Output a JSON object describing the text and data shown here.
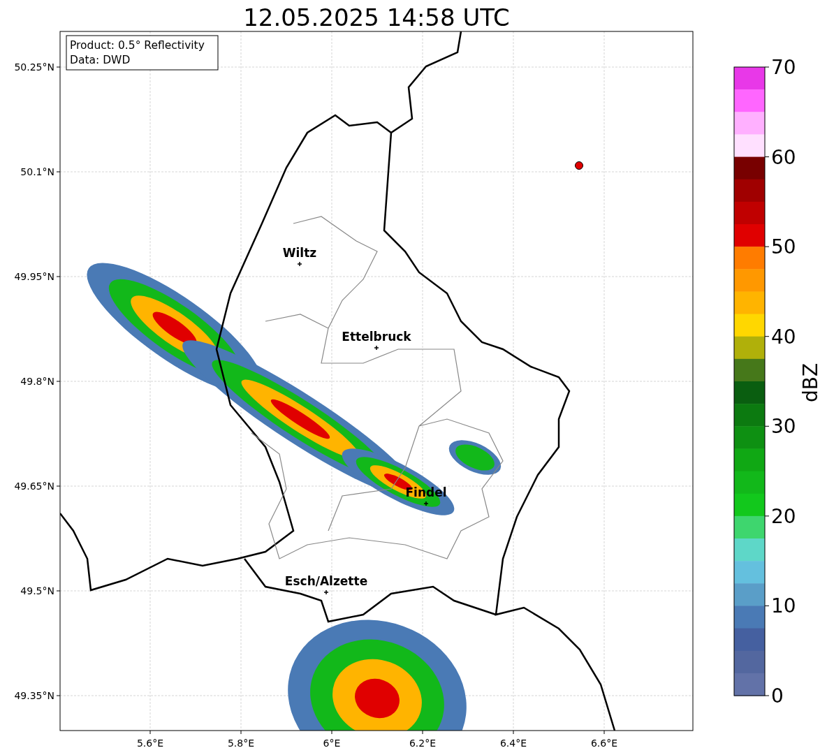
{
  "title": "12.05.2025 14:58 UTC",
  "info_box": [
    "Product: 0.5° Reflectivity",
    "Data: DWD"
  ],
  "y_axis": {
    "ticks": [
      "50.25°N",
      "50.1°N",
      "49.95°N",
      "49.8°N",
      "49.65°N",
      "49.5°N",
      "49.35°N"
    ]
  },
  "cities": [
    {
      "name": "Wiltz"
    },
    {
      "name": "Ettelbruck"
    },
    {
      "name": "Findel"
    },
    {
      "name": "Esch/Alzette"
    }
  ],
  "x_axis": {
    "ticks": [
      "5.6°E",
      "5.8°E",
      "6°E",
      "6.2°E",
      "6.4°E",
      "6.6°E"
    ]
  },
  "colorbar": {
    "ticks": [
      "70",
      "60",
      "50",
      "40",
      "30",
      "20",
      "10",
      "0"
    ],
    "label": "dBZ",
    "segments": [
      {
        "color": "#e838e8"
      },
      {
        "color": "#ff66ff"
      },
      {
        "color": "#ffb0ff"
      },
      {
        "color": "#ffe0ff"
      },
      {
        "color": "#780000"
      },
      {
        "color": "#a00000"
      },
      {
        "color": "#c00000"
      },
      {
        "color": "#e00000"
      },
      {
        "color": "#ff7c00"
      },
      {
        "color": "#ff9800"
      },
      {
        "color": "#ffb400"
      },
      {
        "color": "#ffd700"
      },
      {
        "color": "#b0b00a"
      },
      {
        "color": "#46781a"
      },
      {
        "color": "#0a5e10"
      },
      {
        "color": "#0c7a10"
      },
      {
        "color": "#0e9012"
      },
      {
        "color": "#10a814"
      },
      {
        "color": "#12b81a"
      },
      {
        "color": "#12c81c"
      },
      {
        "color": "#3ed66e"
      },
      {
        "color": "#5ed7c8"
      },
      {
        "color": "#64c0de"
      },
      {
        "color": "#5a9ec8"
      },
      {
        "color": "#4a7ab5"
      },
      {
        "color": "#4560a0"
      },
      {
        "color": "#53679f"
      },
      {
        "color": "#6272a8"
      }
    ]
  }
}
